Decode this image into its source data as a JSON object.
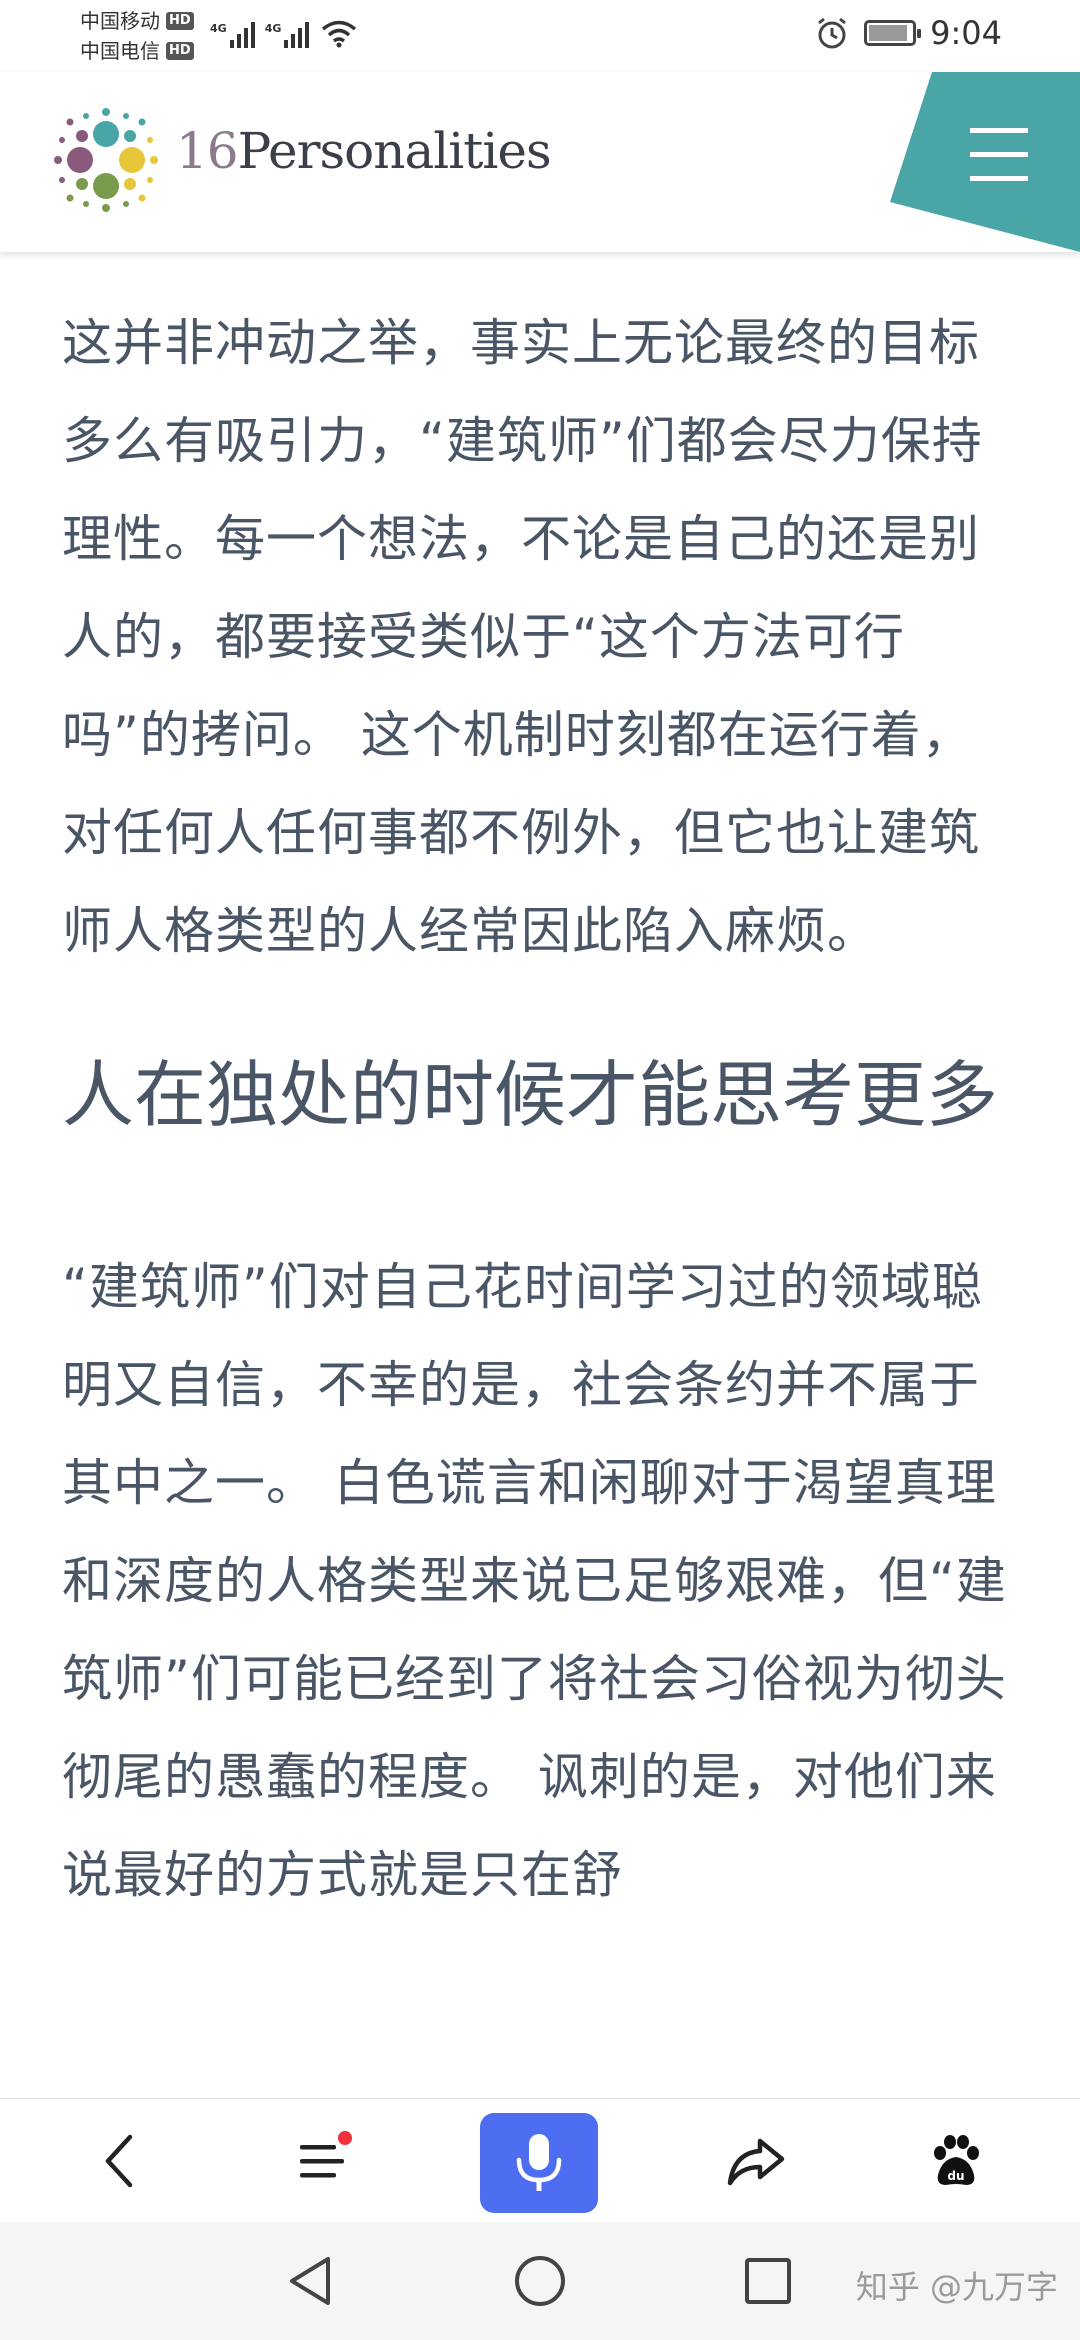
{
  "status_bar": {
    "carrier_1": "中国移动",
    "carrier_2": "中国电信",
    "hd_badge": "HD",
    "network_1": "4G",
    "network_2": "4G",
    "time": "9:04"
  },
  "header": {
    "brand_number": "16",
    "brand_name": "Personalities",
    "menu_icon": "hamburger-menu-icon",
    "accent_color": "#4aa5a6"
  },
  "article": {
    "paragraph_1": "这并非冲动之举，事实上无论最终的目标多么有吸引力，“建筑师”们都会尽力保持理性。每一个想法，不论是自己的还是别人的，都要接受类似于“这个方法可行吗”的拷问。 这个机制时刻都在运行着，对任何人任何事都不例外，但它也让建筑师人格类型的人经常因此陷入麻烦。",
    "heading": "人在独处的时候才能思考更多",
    "paragraph_2": "“建筑师”们对自己花时间学习过的领域聪明又自信，不幸的是，社会条约并不属于其中之一。 白色谎言和闲聊对于渴望真理和深度的人格类型来说已足够艰难，但“建筑师”们可能已经到了将社会习俗视为彻头彻尾的愚蠢的程度。 讽刺的是，对他们来说最好的方式就是只在舒"
  },
  "toolbar": {
    "back_icon": "back-arrow-icon",
    "menu_icon": "list-menu-icon",
    "mic_icon": "microphone-icon",
    "share_icon": "share-icon",
    "baidu_icon": "baidu-paw-icon",
    "mic_color": "#4e6ef2",
    "notification_color": "#f0313b"
  },
  "navbar": {
    "back_icon": "nav-back-triangle-icon",
    "home_icon": "nav-home-circle-icon",
    "recents_icon": "nav-recents-square-icon",
    "watermark": "知乎 @九万字"
  }
}
